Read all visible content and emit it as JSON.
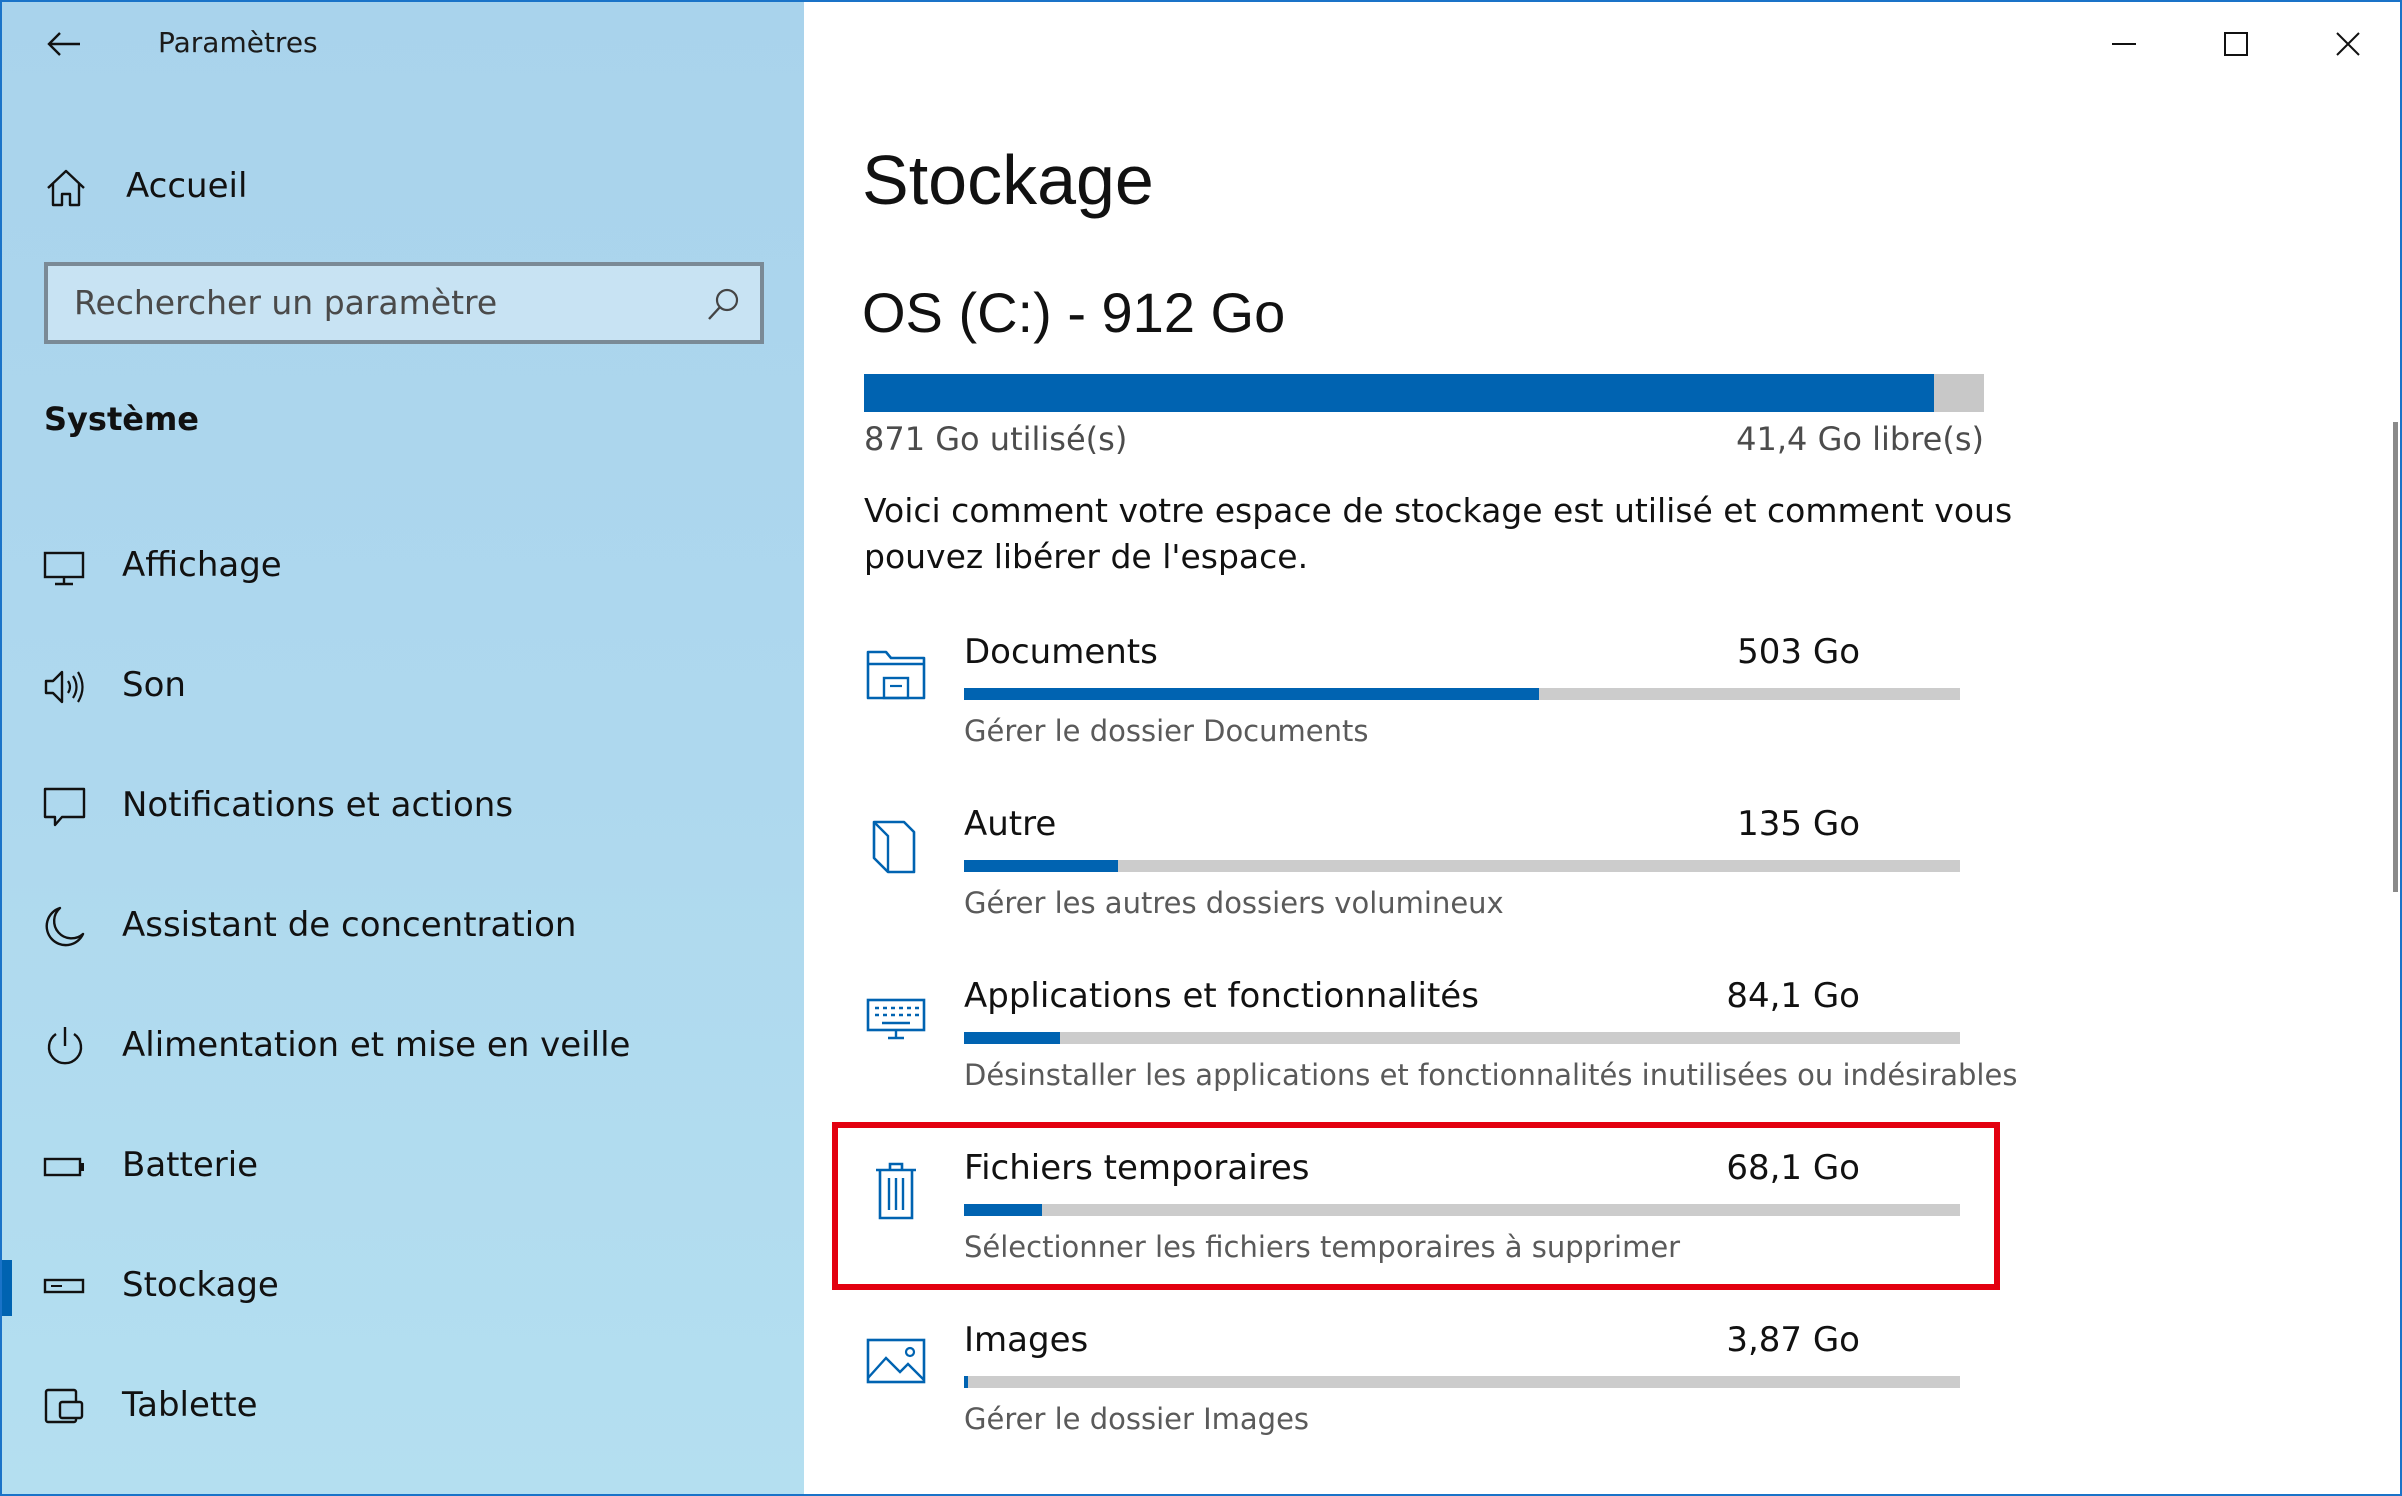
{
  "window": {
    "title": "Paramètres",
    "controls": {
      "minimize": "minimize-icon",
      "maximize": "maximize-icon",
      "close": "close-icon"
    }
  },
  "sidebar": {
    "home_label": "Accueil",
    "search_placeholder": "Rechercher un paramètre",
    "section_label": "Système",
    "items": [
      {
        "label": "Affichage",
        "icon": "monitor-icon",
        "active": false
      },
      {
        "label": "Son",
        "icon": "speaker-icon",
        "active": false
      },
      {
        "label": "Notifications et actions",
        "icon": "notification-icon",
        "active": false
      },
      {
        "label": "Assistant de concentration",
        "icon": "moon-icon",
        "active": false
      },
      {
        "label": "Alimentation et mise en veille",
        "icon": "power-icon",
        "active": false
      },
      {
        "label": "Batterie",
        "icon": "battery-icon",
        "active": false
      },
      {
        "label": "Stockage",
        "icon": "storage-icon",
        "active": true
      },
      {
        "label": "Tablette",
        "icon": "tablet-icon",
        "active": false
      }
    ]
  },
  "main": {
    "page_title": "Stockage",
    "drive": {
      "title": "OS (C:) - 912 Go",
      "used_label": "871 Go utilisé(s)",
      "free_label": "41,4 Go libre(s)",
      "used_fraction": 0.955
    },
    "description": "Voici comment votre espace de stockage est utilisé et comment vous pouvez libérer de l'espace.",
    "categories": [
      {
        "name": "Documents",
        "size": "503 Go",
        "sub": "Gérer le dossier Documents",
        "fraction": 0.577,
        "icon": "documents-folder-icon"
      },
      {
        "name": "Autre",
        "size": "135 Go",
        "sub": "Gérer les autres dossiers volumineux",
        "fraction": 0.155,
        "icon": "other-folder-icon"
      },
      {
        "name": "Applications et fonctionnalités",
        "size": "84,1 Go",
        "sub": "Désinstaller les applications et fonctionnalités inutilisées ou indésirables",
        "fraction": 0.096,
        "icon": "keyboard-icon"
      },
      {
        "name": "Fichiers temporaires",
        "size": "68,1 Go",
        "sub": "Sélectionner les fichiers temporaires à supprimer",
        "fraction": 0.078,
        "icon": "trash-icon",
        "highlighted": true
      },
      {
        "name": "Images",
        "size": "3,87 Go",
        "sub": "Gérer le dossier Images",
        "fraction": 0.004,
        "icon": "image-icon"
      }
    ]
  },
  "colors": {
    "accent": "#0063b1",
    "highlight": "#e3000f",
    "sidebar": "#aed8ee",
    "bar_track": "#cccccc"
  }
}
